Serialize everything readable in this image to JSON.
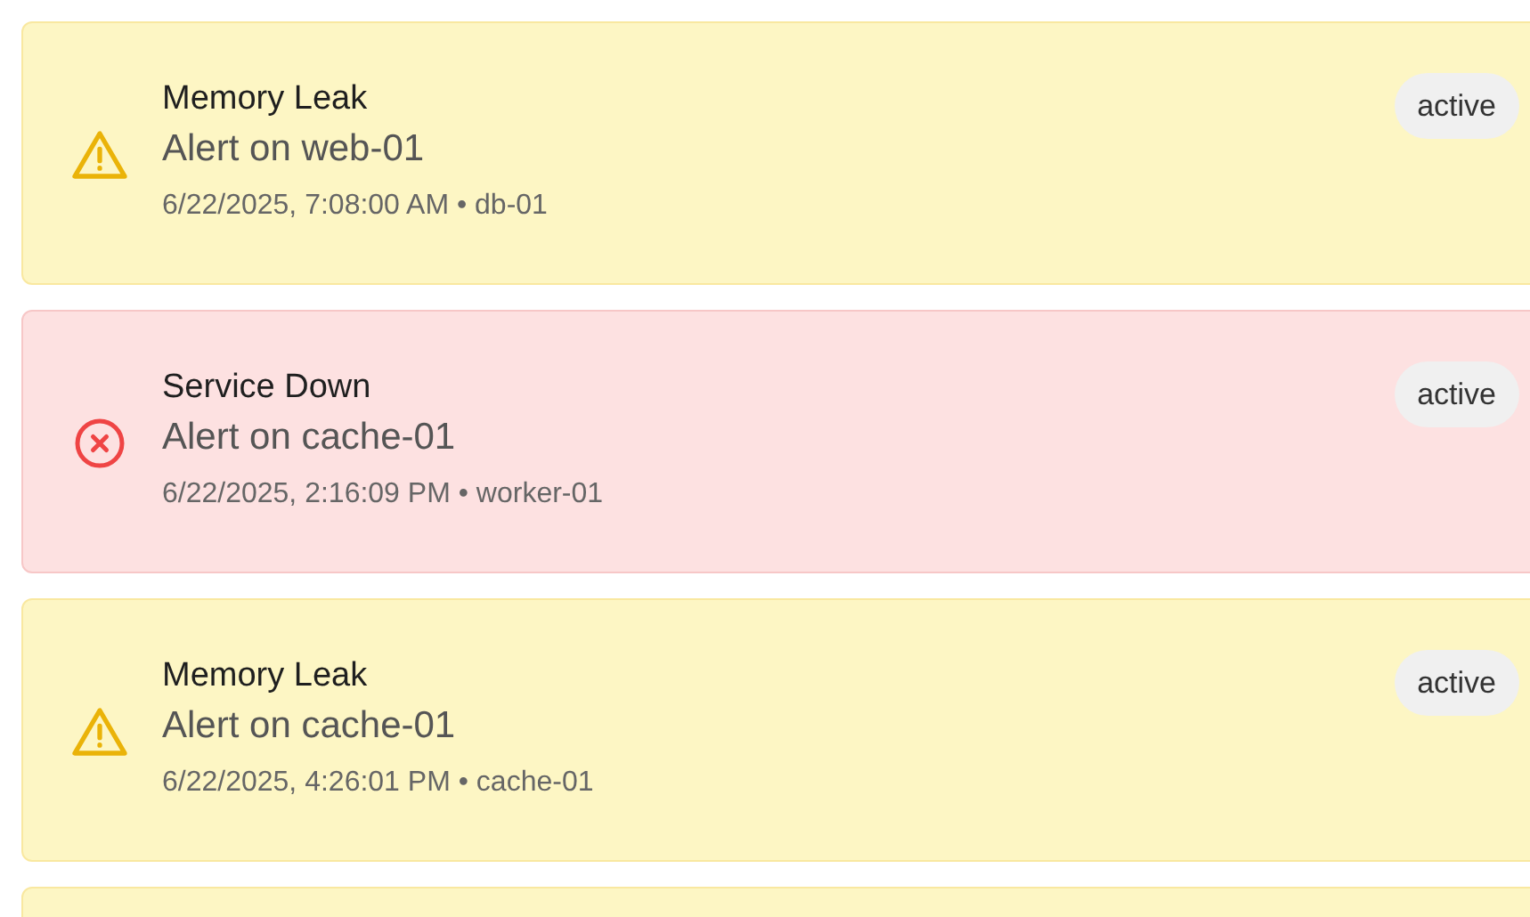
{
  "alerts": [
    {
      "kind": "warning",
      "title": "Memory Leak",
      "message": "Alert on web-01",
      "timestamp": "6/22/2025, 7:08:00 AM",
      "host": "db-01",
      "separator": "•",
      "status": "active"
    },
    {
      "kind": "error",
      "title": "Service Down",
      "message": "Alert on cache-01",
      "timestamp": "6/22/2025, 2:16:09 PM",
      "host": "worker-01",
      "separator": "•",
      "status": "active"
    },
    {
      "kind": "warning",
      "title": "Memory Leak",
      "message": "Alert on cache-01",
      "timestamp": "6/22/2025, 4:26:01 PM",
      "host": "cache-01",
      "separator": "•",
      "status": "active"
    },
    {
      "kind": "warning"
    }
  ]
}
